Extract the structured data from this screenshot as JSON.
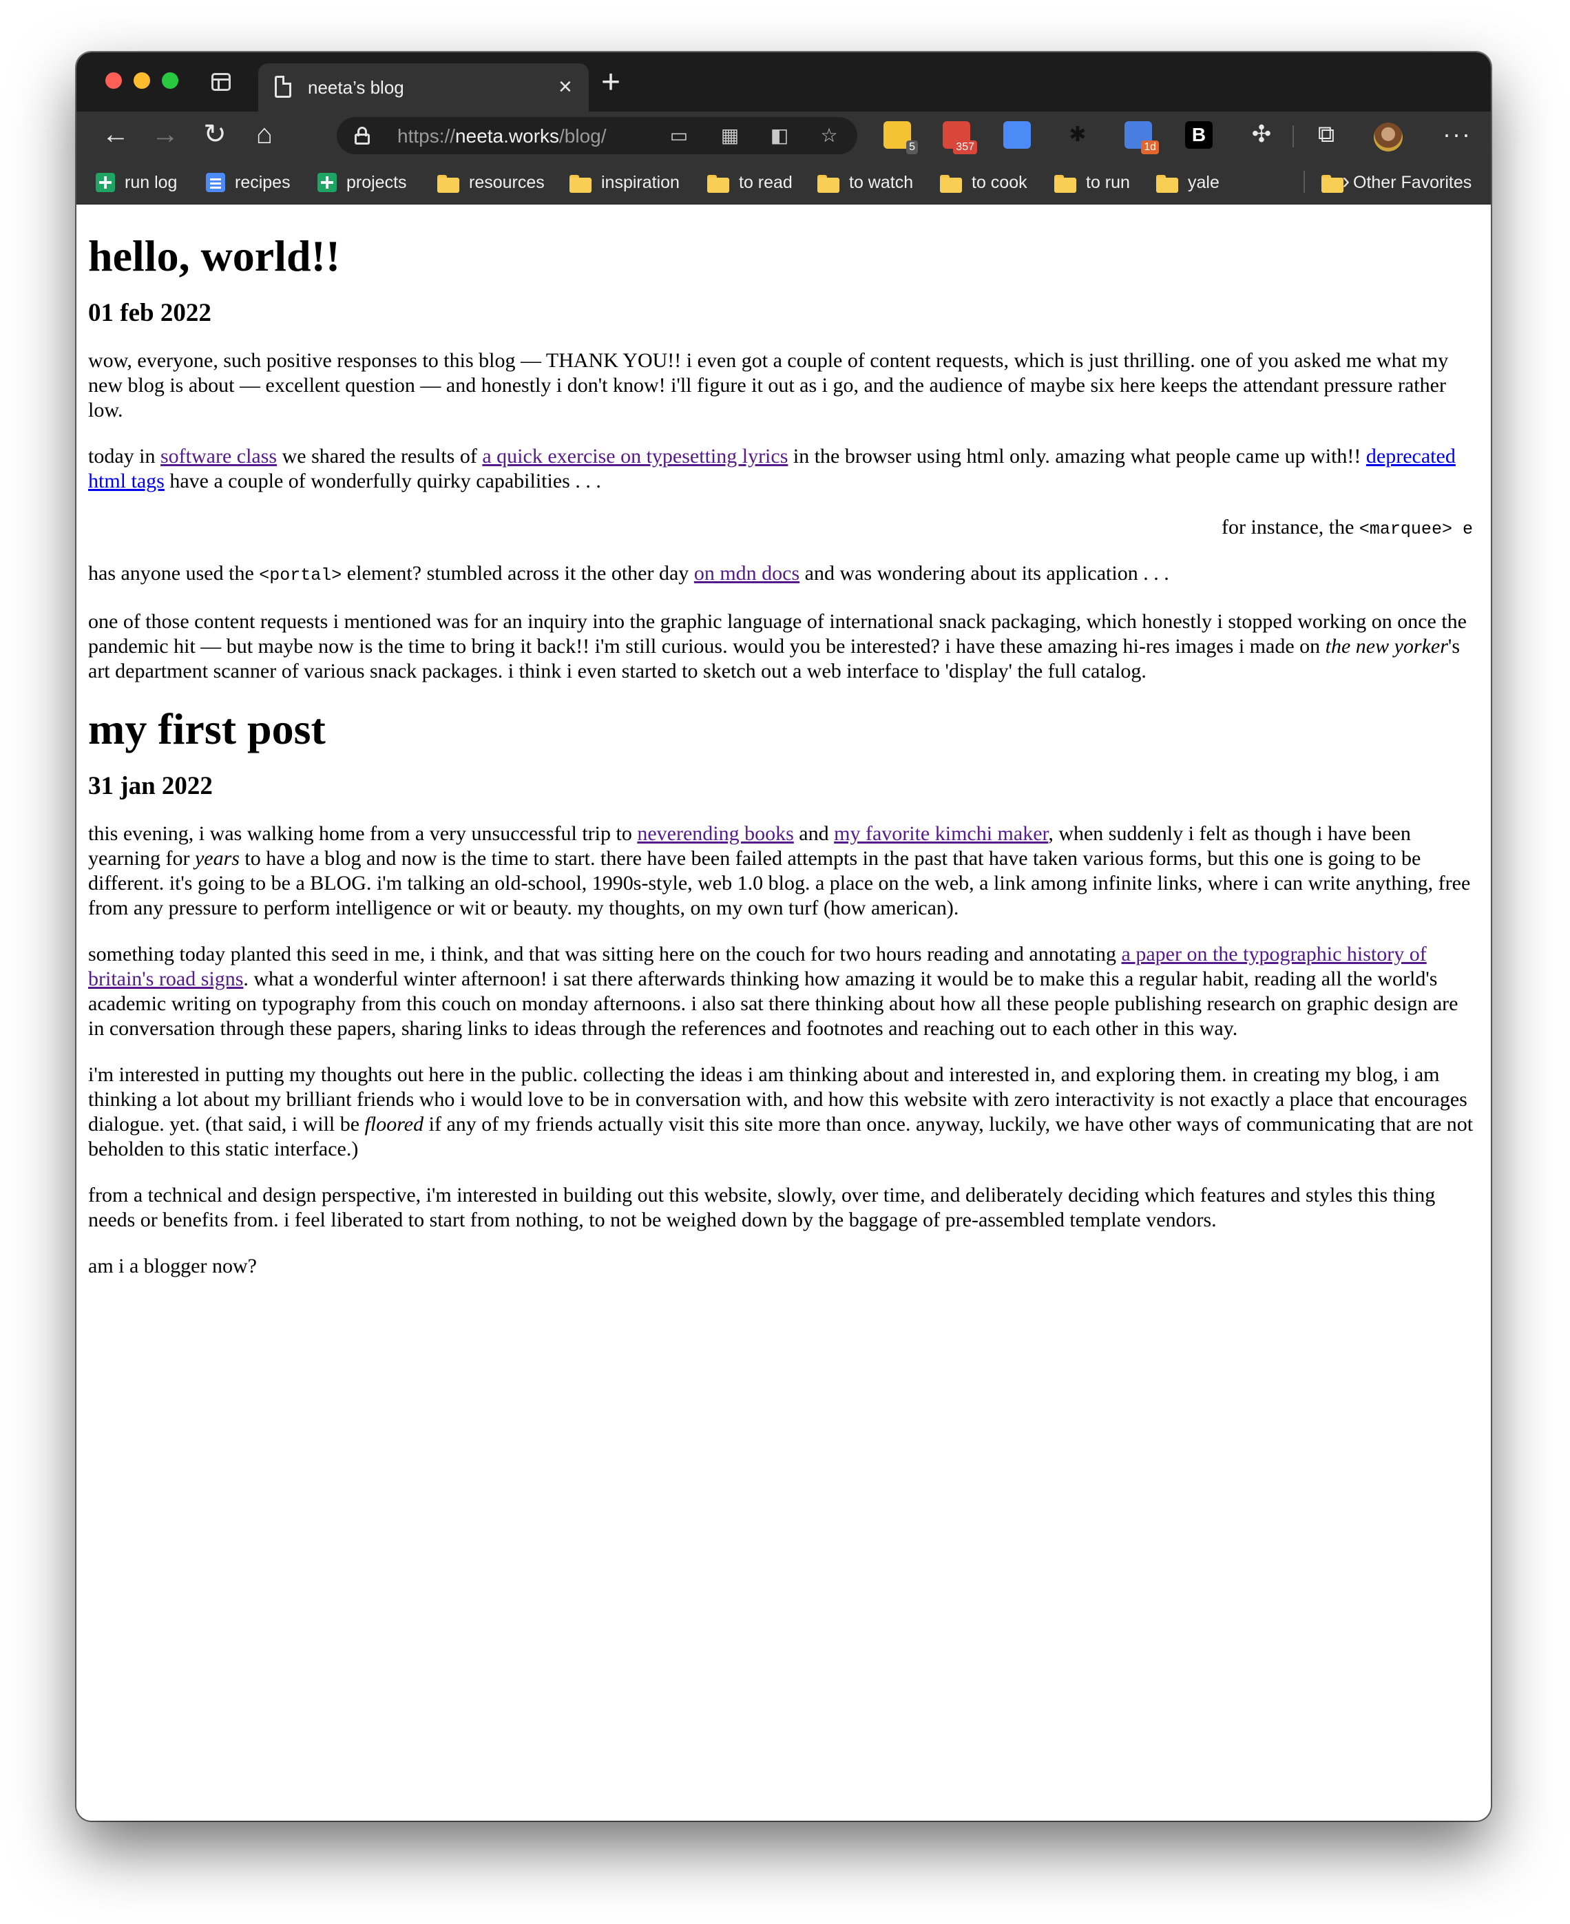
{
  "browser": {
    "tab_title": "neeta’s blog",
    "tab_close_glyph": "×",
    "new_tab_glyph": "+",
    "url_scheme": "https://",
    "url_host": "neeta.works",
    "url_path": "/blog/",
    "extensions": [
      {
        "name": "sticky-notes",
        "badge": "5",
        "color": "#f3c235"
      },
      {
        "name": "gmail",
        "badge": "357",
        "color": "#d9473b"
      },
      {
        "name": "google-translate",
        "badge": "",
        "color": "#4c8bf5"
      },
      {
        "name": "asterisk",
        "badge": "",
        "color": "#333333"
      },
      {
        "name": "calendar",
        "badge": "1d",
        "color": "#4a7de0"
      },
      {
        "name": "bold-b",
        "badge": "",
        "color": "#000000"
      }
    ],
    "more_glyph": "···"
  },
  "bookmarks": [
    {
      "label": "run log",
      "icon": "sheet"
    },
    {
      "label": "recipes",
      "icon": "doc"
    },
    {
      "label": "projects",
      "icon": "sheet"
    },
    {
      "label": "resources",
      "icon": "folder"
    },
    {
      "label": "inspiration",
      "icon": "folder"
    },
    {
      "label": "to read",
      "icon": "folder"
    },
    {
      "label": "to watch",
      "icon": "folder"
    },
    {
      "label": "to cook",
      "icon": "folder"
    },
    {
      "label": "to run",
      "icon": "folder"
    },
    {
      "label": "yale",
      "icon": "folder"
    }
  ],
  "other_favorites": "Other Favorites",
  "post1": {
    "title": "hello, world!!",
    "date": "01 feb 2022",
    "p1": "wow, everyone, such positive responses to this blog — THANK YOU!! i even got a couple of content requests, which is just thrilling. one of you asked me what my new blog is about — excellent question — and honestly i don't know! i'll figure it out as i go, and the audience of maybe six here keeps the attendant pressure rather low.",
    "p2_a": "today in ",
    "p2_link1": "software class",
    "p2_b": " we shared the results of ",
    "p2_link2": "a quick exercise on typesetting lyrics",
    "p2_c": " in the browser using html only. amazing what people came up with!! ",
    "p2_link3": "deprecated html tags",
    "p2_d": " have a couple of wonderfully quirky capabilities . . .",
    "marquee_text": "for instance, the ",
    "marquee_code": "<marquee> e",
    "p3_a": "has anyone used the ",
    "p3_code": "<portal>",
    "p3_b": " element? stumbled across it the other day ",
    "p3_link": "on mdn docs",
    "p3_c": " and was wondering about its application . . .",
    "p4_a": "one of those content requests i mentioned was for an inquiry into the graphic language of international snack packaging, which honestly i stopped working on once the pandemic hit — but maybe now is the time to bring it back!! i'm still curious. would you be interested? i have these amazing hi-res images i made on ",
    "p4_em": "the new yorker",
    "p4_b": "'s art department scanner of various snack packages. i think i even started to sketch out a web interface to 'display' the full catalog."
  },
  "post2": {
    "title": "my first post",
    "date": "31 jan 2022",
    "p1_a": "this evening, i was walking home from a very unsuccessful trip to ",
    "p1_link1": "neverending books",
    "p1_b": " and ",
    "p1_link2": "my favorite kimchi maker",
    "p1_c": ", when suddenly i felt as though i have been yearning for ",
    "p1_em": "years",
    "p1_d": " to have a blog and now is the time to start. there have been failed attempts in the past that have taken various forms, but this one is going to be different. it's going to be a BLOG. i'm talking an old-school, 1990s-style, web 1.0 blog. a place on the web, a link among infinite links, where i can write anything, free from any pressure to perform intelligence or wit or beauty. my thoughts, on my own turf (how american).",
    "p2_a": "something today planted this seed in me, i think, and that was sitting here on the couch for two hours reading and annotating ",
    "p2_link": "a paper on the typographic history of britain's road signs",
    "p2_b": ". what a wonderful winter afternoon! i sat there afterwards thinking how amazing it would be to make this a regular habit, reading all the world's academic writing on typography from this couch on monday afternoons. i also sat there thinking about how all these people publishing research on graphic design are in conversation through these papers, sharing links to ideas through the references and footnotes and reaching out to each other in this way.",
    "p3_a": "i'm interested in putting my thoughts out here in the public. collecting the ideas i am thinking about and interested in, and exploring them. in creating my blog, i am thinking a lot about my brilliant friends who i would love to be in conversation with, and how this website with zero interactivity is not exactly a place that encourages dialogue. yet. (that said, i will be ",
    "p3_em": "floored",
    "p3_b": " if any of my friends actually visit this site more than once. anyway, luckily, we have other ways of communicating that are not beholden to this static interface.)",
    "p4": "from a technical and design perspective, i'm interested in building out this website, slowly, over time, and deliberately deciding which features and styles this thing needs or benefits from. i feel liberated to start from nothing, to not be weighed down by the baggage of pre-assembled template vendors.",
    "p5": "am i a blogger now?"
  }
}
